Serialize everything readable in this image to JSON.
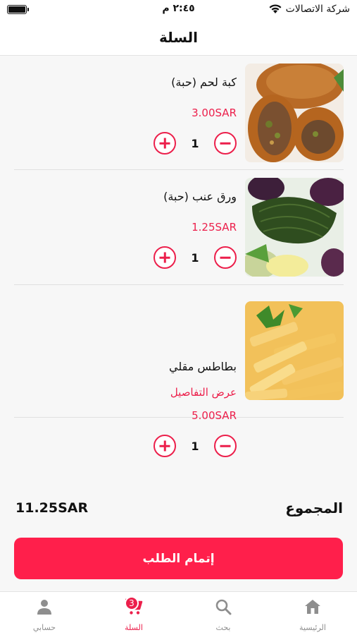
{
  "status_bar": {
    "carrier": "شركة الاتصالات",
    "time": "٢:٤٥ م",
    "battery_level": 1.0
  },
  "header": {
    "title": "السلة"
  },
  "cart": {
    "items": [
      {
        "name": "كبة لحم (حبة)",
        "price": "3.00SAR",
        "quantity": "1",
        "image": "kibbeh-photo"
      },
      {
        "name": "ورق عنب (حبة)",
        "price": "1.25SAR",
        "quantity": "1",
        "image": "stuffed-grape-leaves-photo"
      },
      {
        "name": "بطاطس مقلي",
        "details_link": "عرض التفاصيل",
        "price": "5.00SAR",
        "quantity": "1",
        "image": "french-fries-photo"
      }
    ]
  },
  "summary": {
    "total_label": "المجموع",
    "total_value": "11.25SAR"
  },
  "checkout": {
    "label": "إتمام الطلب"
  },
  "tabs": [
    {
      "label": "حسابي",
      "icon": "person-icon",
      "active": false
    },
    {
      "label": "السلة",
      "icon": "cart-icon",
      "active": true,
      "badge": "3"
    },
    {
      "label": "بحث",
      "icon": "search-icon",
      "active": false
    },
    {
      "label": "الرئيسية",
      "icon": "home-icon",
      "active": false
    }
  ],
  "colors": {
    "accent": "#ec1f4b",
    "button": "#ff1f4b",
    "background": "#f7f7f7",
    "inactive_tab": "#8e8e8e"
  }
}
